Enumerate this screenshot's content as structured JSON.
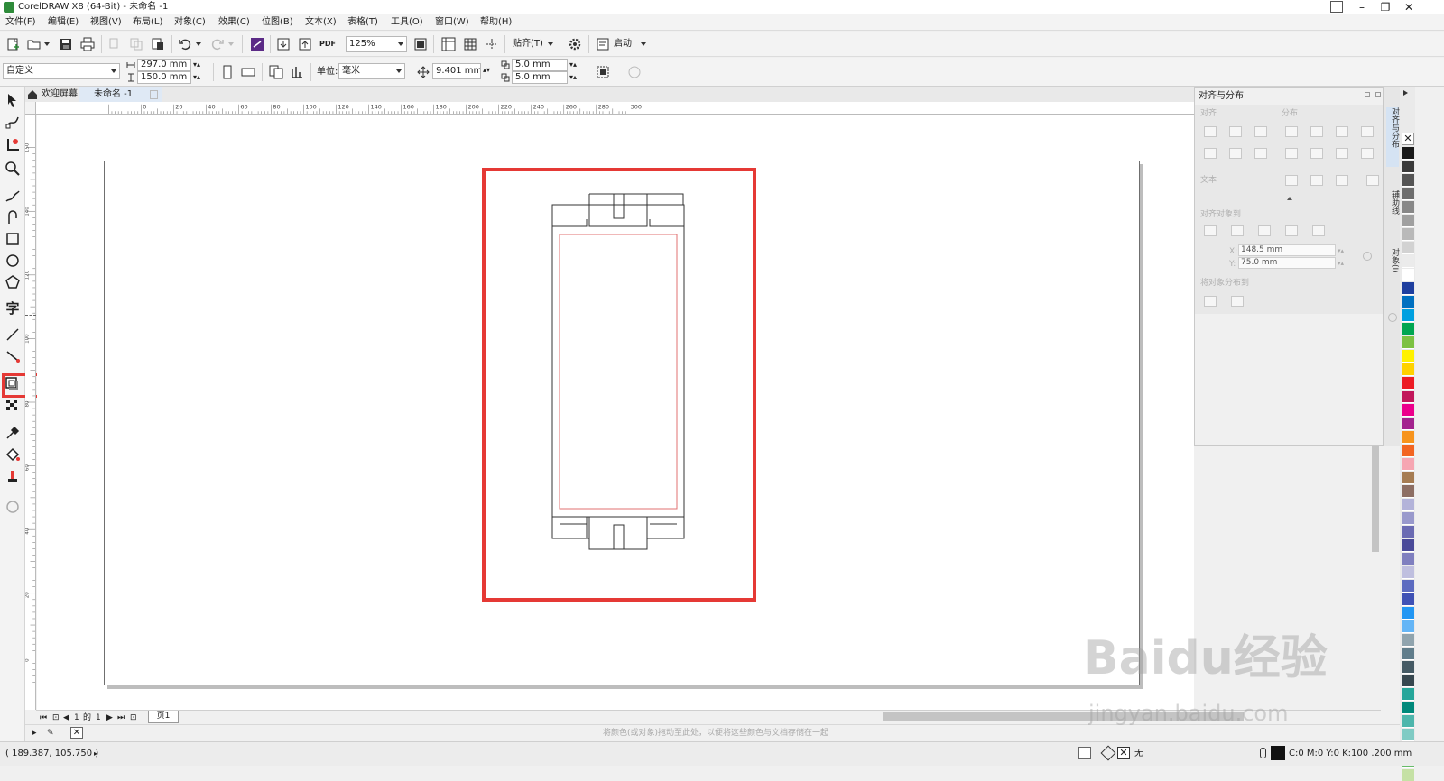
{
  "window": {
    "title": "CorelDRAW X8 (64-Bit) - 未命名 -1",
    "minimize_glyph": "–",
    "restore_glyph": "❐",
    "close_glyph": "✕"
  },
  "menu": [
    "文件(F)",
    "编辑(E)",
    "视图(V)",
    "布局(L)",
    "对象(C)",
    "效果(C)",
    "位图(B)",
    "文本(X)",
    "表格(T)",
    "工具(O)",
    "窗口(W)",
    "帮助(H)"
  ],
  "standard_toolbar": {
    "zoom": "125%",
    "pdf_label": "PDF",
    "snap": "贴齐(T)",
    "launch": "启动"
  },
  "property_bar": {
    "page_preset": "自定义",
    "page_width": "297.0 mm",
    "page_height": "150.0 mm",
    "units_label": "单位:",
    "units_value": "毫米",
    "nudge": "9.401 mm",
    "dup_x": "5.0 mm",
    "dup_y": "5.0 mm"
  },
  "tabs": {
    "welcome": "欢迎屏幕",
    "document": "未命名 -1"
  },
  "ruler": {
    "h_labels": [
      "0",
      "20",
      "40",
      "60",
      "80",
      "100",
      "120",
      "140",
      "160",
      "180",
      "200",
      "220",
      "240",
      "260",
      "280",
      "300"
    ],
    "v_labels": [
      "150",
      "140",
      "120",
      "100",
      "80",
      "60",
      "40",
      "20",
      "0"
    ]
  },
  "docker": {
    "title": "对齐与分布",
    "align_label": "对齐",
    "distribute_label": "分布",
    "text_label": "文本",
    "align_to_label": "对齐对象到",
    "x_label": "X:",
    "x_value": "148.5 mm",
    "y_label": "Y:",
    "y_value": "75.0 mm",
    "distribute_to_label": "将对象分布到"
  },
  "docker_tabs": [
    "对齐与分布",
    "辅助线",
    "对象(I)"
  ],
  "page_nav": {
    "current": "1",
    "of": "的",
    "total": "1",
    "page_tab": "页1"
  },
  "doc_palette_hint": "将颜色(或对象)拖动至此处，以便将这些颜色与文档存储在一起",
  "status": {
    "coords": "( 189.387, 105.750 )",
    "fill_none": "无",
    "outline_info": "C:0 M:0 Y:0 K:100 .200 mm"
  },
  "watermark": {
    "line1": "Baidu经验",
    "line2": "jingyan.baidu.com"
  },
  "palette_colors": [
    "#1a1a1a",
    "#3a3a3a",
    "#555555",
    "#6e6e6e",
    "#888888",
    "#a0a0a0",
    "#b9b9b9",
    "#d2d2d2",
    "#ebebeb",
    "#ffffff",
    "#1f3f9f",
    "#0070c0",
    "#00a0e0",
    "#00a651",
    "#7dc242",
    "#fff200",
    "#ffd200",
    "#ed1c24",
    "#c2185b",
    "#ec008c",
    "#a3238e",
    "#f7941d",
    "#f26522",
    "#f6a6b2",
    "#a67c52",
    "#8d6e63",
    "#b3b3d9",
    "#9999cc",
    "#6b6bb3",
    "#4a4a99",
    "#7f7fbf",
    "#bfbfdf",
    "#5c6bc0",
    "#3f51b5",
    "#2196f3",
    "#64b5f6",
    "#90a4ae",
    "#607d8b",
    "#455a64",
    "#37474f",
    "#26a69a",
    "#00897b",
    "#4db6ac",
    "#80cbc4",
    "#a5d6a7",
    "#66bb6a",
    "#c5e1a5",
    "#dcedc8"
  ],
  "highlight_color": "#e53935"
}
